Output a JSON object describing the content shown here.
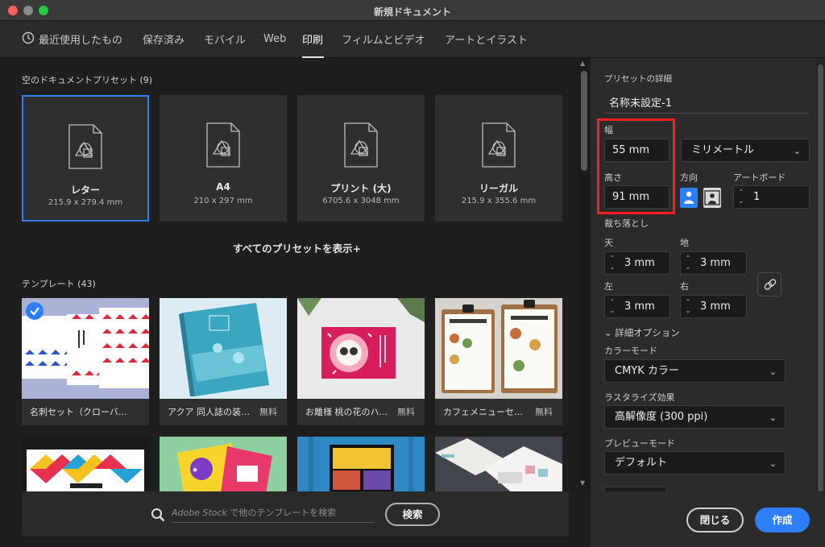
{
  "window": {
    "title": "新規ドキュメント"
  },
  "tabs": [
    {
      "label": "最近使用したもの",
      "icon": "clock-icon"
    },
    {
      "label": "保存済み"
    },
    {
      "label": "モバイル"
    },
    {
      "label": "Web"
    },
    {
      "label": "印刷",
      "active": true
    },
    {
      "label": "フィルムとビデオ"
    },
    {
      "label": "アートとイラスト"
    }
  ],
  "blank_presets": {
    "heading": "空のドキュメントプリセット",
    "count": "(9)",
    "items": [
      {
        "name": "レター",
        "size": "215.9 x 279.4 mm",
        "selected": true
      },
      {
        "name": "A4",
        "size": "210 x 297 mm"
      },
      {
        "name": "プリント (大)",
        "size": "6705.6 x 3048 mm"
      },
      {
        "name": "リーガル",
        "size": "215.9 x 355.6 mm"
      }
    ],
    "show_all": "すべてのプリセットを表示+"
  },
  "templates": {
    "heading": "テンプレート",
    "count": "(43)",
    "items": [
      {
        "name": "名刺セット（クローバ…",
        "free": "",
        "checked": true
      },
      {
        "name": "アクア 同人誌の装…",
        "free": "無料"
      },
      {
        "name": "お離様 桃の花のハ…",
        "free": "無料"
      },
      {
        "name": "カフェメニューセ…",
        "free": "無料"
      }
    ]
  },
  "search": {
    "placeholder_brand": "Adobe Stock",
    "placeholder_rest": " で他のテンプレートを検索",
    "button": "検索"
  },
  "details": {
    "heading": "プリセットの詳細",
    "doc_name": "名称未設定-1",
    "width_label": "幅",
    "width_value": "55 mm",
    "units_value": "ミリメートル",
    "height_label": "高さ",
    "height_value": "91 mm",
    "orientation_label": "方向",
    "artboard_label": "アートボード",
    "artboard_value": "1",
    "bleed_label": "裁ち落とし",
    "bleed_top_label": "天",
    "bleed_top_value": "3 mm",
    "bleed_bottom_label": "地",
    "bleed_bottom_value": "3 mm",
    "bleed_left_label": "左",
    "bleed_left_value": "3 mm",
    "bleed_right_label": "右",
    "bleed_right_value": "3 mm",
    "advanced_label": "詳細オプション",
    "color_mode_label": "カラーモード",
    "color_mode_value": "CMYK カラー",
    "raster_label": "ラスタライズ効果",
    "raster_value": "高解像度 (300 ppi)",
    "preview_label": "プレビューモード",
    "preview_value": "デフォルト"
  },
  "actions": {
    "close": "閉じる",
    "create": "作成"
  },
  "colors": {
    "accent": "#2d7ff9",
    "highlight_box": "#ff1e1e"
  }
}
